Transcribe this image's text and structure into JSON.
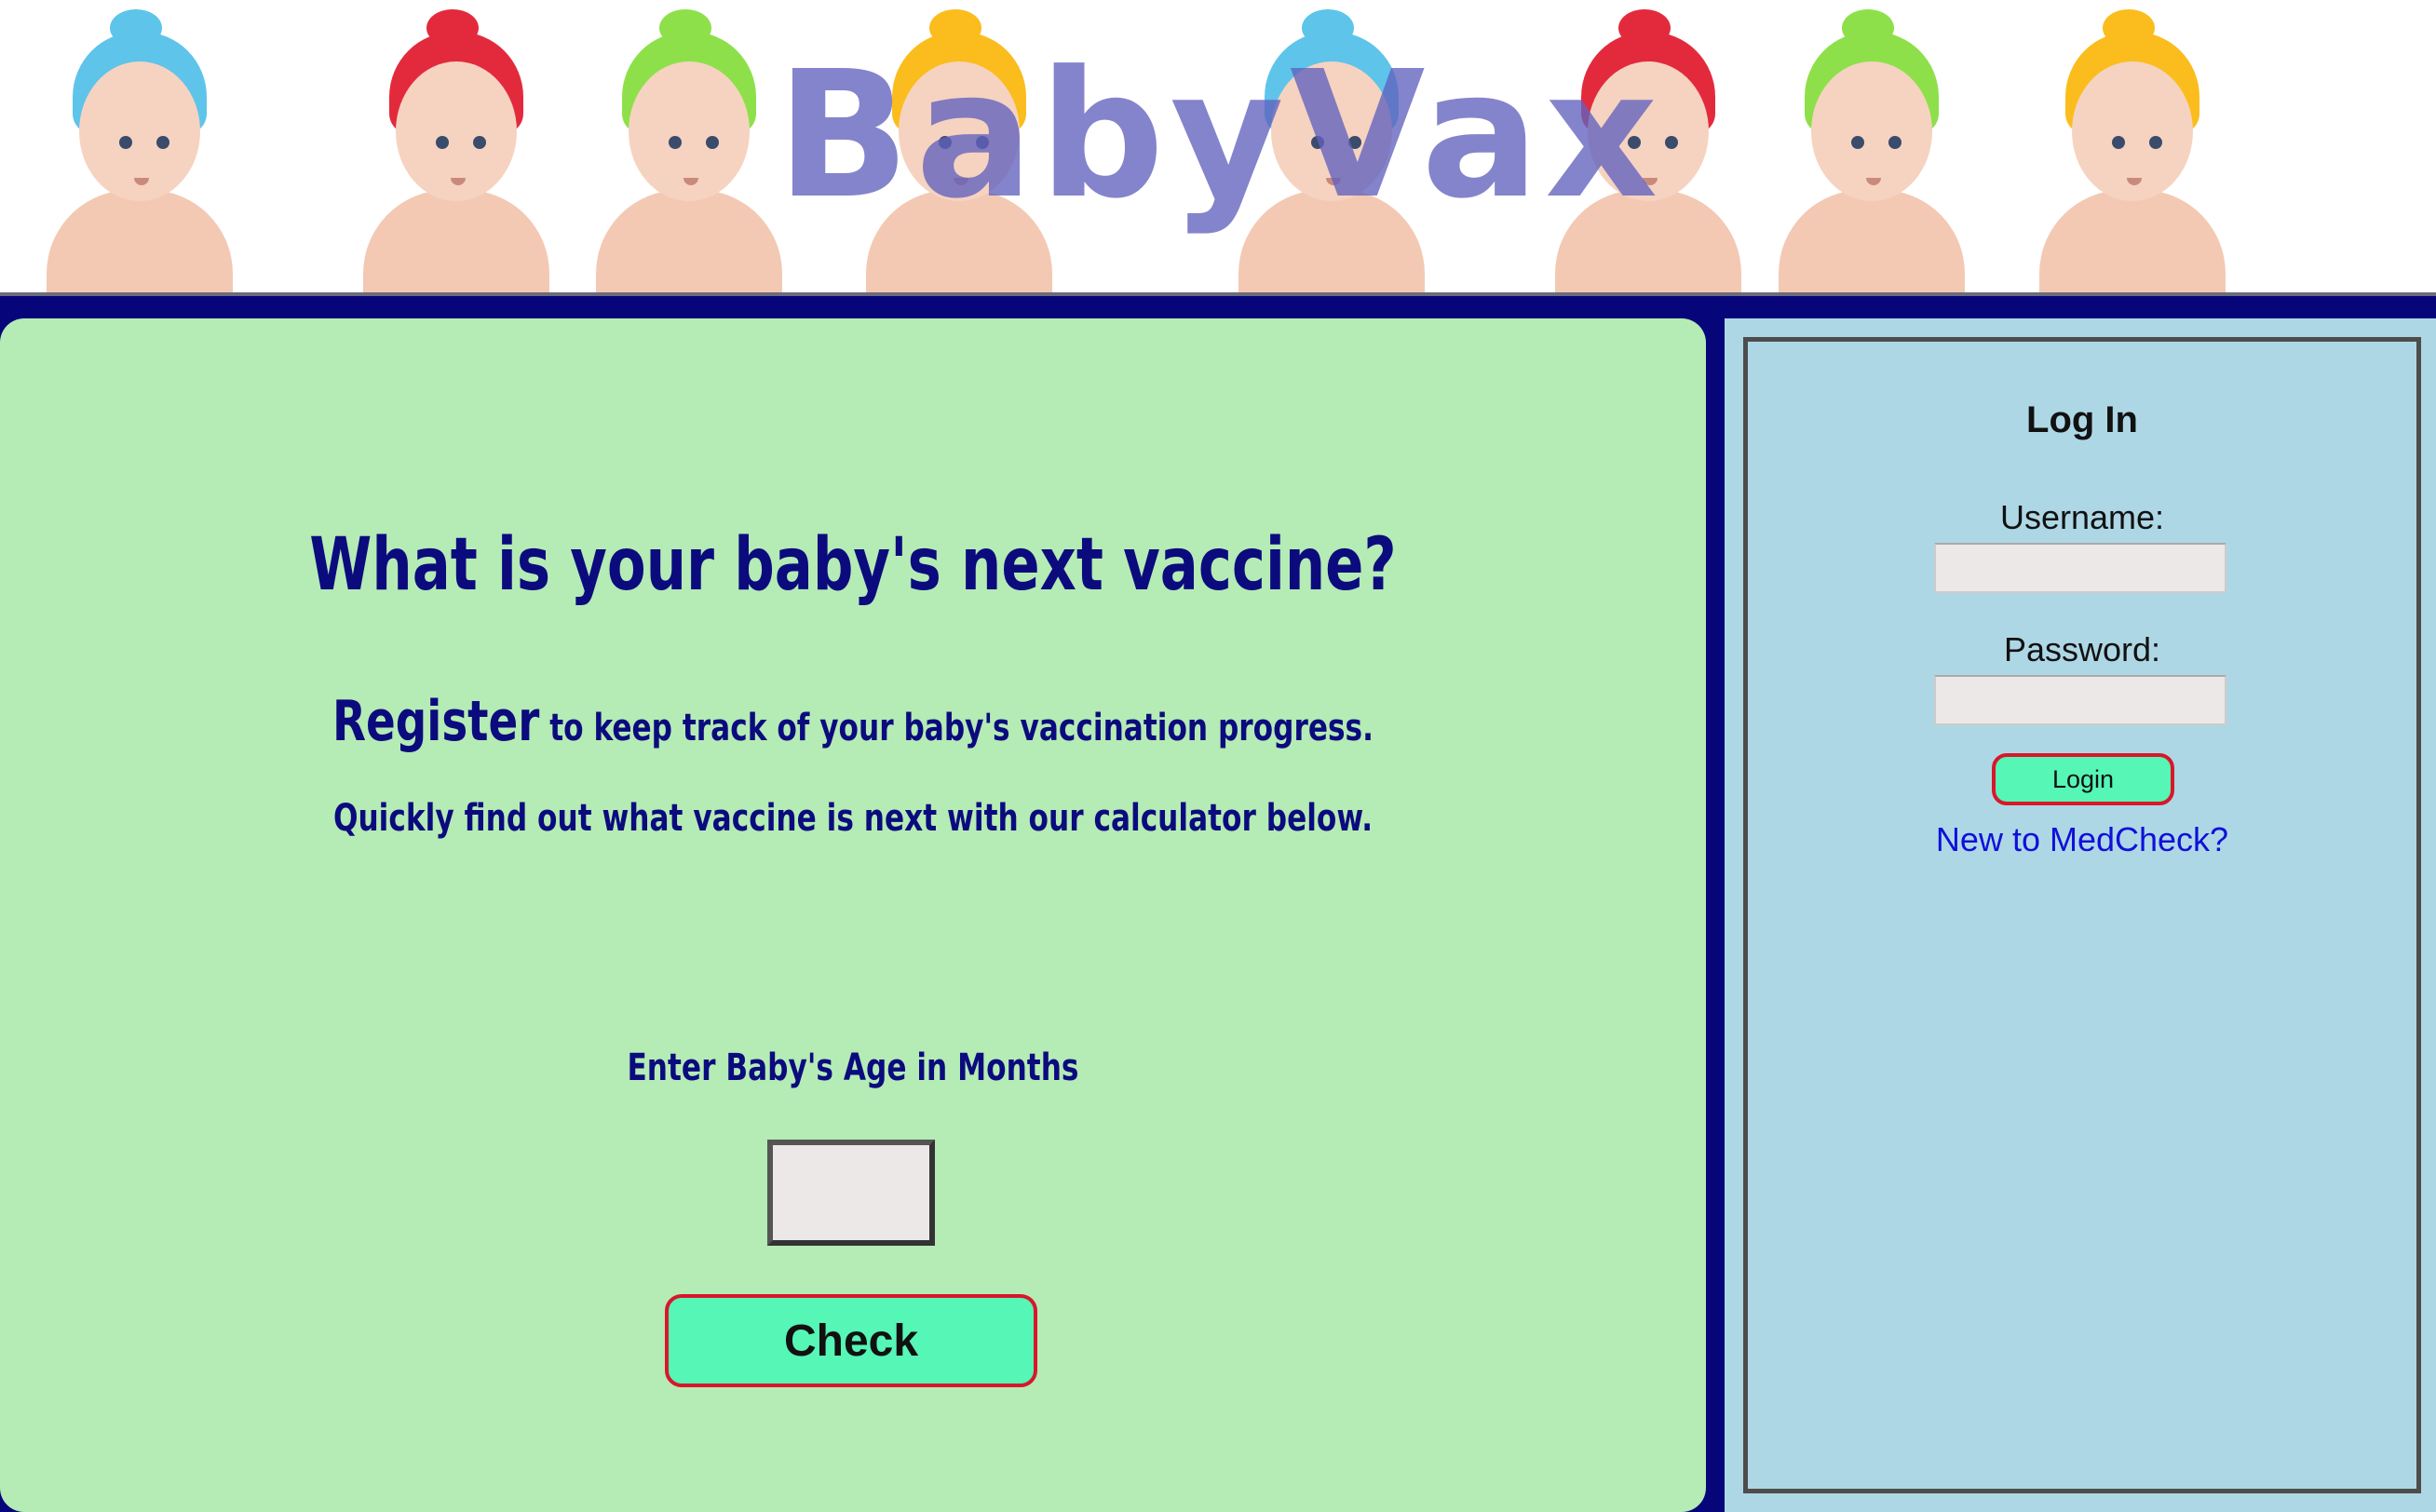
{
  "header": {
    "site_title": "BabyVax",
    "hat_colors": [
      "#5ec4ea",
      "#e32a3d",
      "#8ee04a",
      "#fbbd1d",
      "#5ec4ea",
      "#e32a3d",
      "#8ee04a",
      "#fbbd1d"
    ]
  },
  "main": {
    "headline": "What is your baby's next vaccine?",
    "register_word": "Register",
    "register_rest": " to keep track of your baby's vaccination progress.",
    "quick_line": "Quickly find out what vaccine is next with our calculator below.",
    "age_label": "Enter Baby's Age in Months",
    "age_value": "",
    "check_label": "Check"
  },
  "login": {
    "title": "Log In",
    "username_label": "Username:",
    "username_value": "",
    "password_label": "Password:",
    "password_value": "",
    "login_label": "Login",
    "register_link": "New to MedCheck?"
  },
  "colors": {
    "page_bg": "#06067a",
    "main_bg": "#b5ebb5",
    "sidebar_bg": "#aed7e6",
    "heading_text": "#0b0b7e",
    "button_bg": "#55f6b6",
    "button_border": "#d8172a",
    "link": "#1010d8"
  }
}
